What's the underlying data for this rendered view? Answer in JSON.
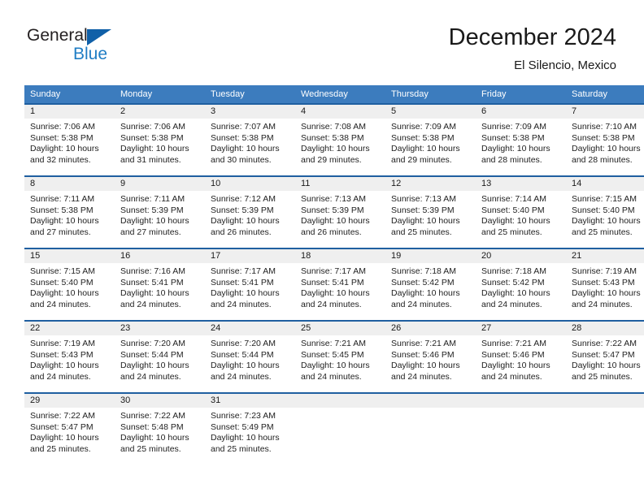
{
  "logo": {
    "word1": "General",
    "word2": "Blue",
    "triangle_color": "#1060a8",
    "blue_color": "#1f7dc4"
  },
  "header": {
    "title": "December 2024",
    "subtitle": "El Silencio, Mexico"
  },
  "theme": {
    "header_bg": "#3c7cbe",
    "row_rule": "#1f5fa0",
    "daynum_bg": "#efefef",
    "text": "#222222"
  },
  "weekday_headers": [
    "Sunday",
    "Monday",
    "Tuesday",
    "Wednesday",
    "Thursday",
    "Friday",
    "Saturday"
  ],
  "weeks": [
    [
      {
        "day": "1",
        "sunrise": "Sunrise: 7:06 AM",
        "sunset": "Sunset: 5:38 PM",
        "daylight1": "Daylight: 10 hours",
        "daylight2": "and 32 minutes."
      },
      {
        "day": "2",
        "sunrise": "Sunrise: 7:06 AM",
        "sunset": "Sunset: 5:38 PM",
        "daylight1": "Daylight: 10 hours",
        "daylight2": "and 31 minutes."
      },
      {
        "day": "3",
        "sunrise": "Sunrise: 7:07 AM",
        "sunset": "Sunset: 5:38 PM",
        "daylight1": "Daylight: 10 hours",
        "daylight2": "and 30 minutes."
      },
      {
        "day": "4",
        "sunrise": "Sunrise: 7:08 AM",
        "sunset": "Sunset: 5:38 PM",
        "daylight1": "Daylight: 10 hours",
        "daylight2": "and 29 minutes."
      },
      {
        "day": "5",
        "sunrise": "Sunrise: 7:09 AM",
        "sunset": "Sunset: 5:38 PM",
        "daylight1": "Daylight: 10 hours",
        "daylight2": "and 29 minutes."
      },
      {
        "day": "6",
        "sunrise": "Sunrise: 7:09 AM",
        "sunset": "Sunset: 5:38 PM",
        "daylight1": "Daylight: 10 hours",
        "daylight2": "and 28 minutes."
      },
      {
        "day": "7",
        "sunrise": "Sunrise: 7:10 AM",
        "sunset": "Sunset: 5:38 PM",
        "daylight1": "Daylight: 10 hours",
        "daylight2": "and 28 minutes."
      }
    ],
    [
      {
        "day": "8",
        "sunrise": "Sunrise: 7:11 AM",
        "sunset": "Sunset: 5:38 PM",
        "daylight1": "Daylight: 10 hours",
        "daylight2": "and 27 minutes."
      },
      {
        "day": "9",
        "sunrise": "Sunrise: 7:11 AM",
        "sunset": "Sunset: 5:39 PM",
        "daylight1": "Daylight: 10 hours",
        "daylight2": "and 27 minutes."
      },
      {
        "day": "10",
        "sunrise": "Sunrise: 7:12 AM",
        "sunset": "Sunset: 5:39 PM",
        "daylight1": "Daylight: 10 hours",
        "daylight2": "and 26 minutes."
      },
      {
        "day": "11",
        "sunrise": "Sunrise: 7:13 AM",
        "sunset": "Sunset: 5:39 PM",
        "daylight1": "Daylight: 10 hours",
        "daylight2": "and 26 minutes."
      },
      {
        "day": "12",
        "sunrise": "Sunrise: 7:13 AM",
        "sunset": "Sunset: 5:39 PM",
        "daylight1": "Daylight: 10 hours",
        "daylight2": "and 25 minutes."
      },
      {
        "day": "13",
        "sunrise": "Sunrise: 7:14 AM",
        "sunset": "Sunset: 5:40 PM",
        "daylight1": "Daylight: 10 hours",
        "daylight2": "and 25 minutes."
      },
      {
        "day": "14",
        "sunrise": "Sunrise: 7:15 AM",
        "sunset": "Sunset: 5:40 PM",
        "daylight1": "Daylight: 10 hours",
        "daylight2": "and 25 minutes."
      }
    ],
    [
      {
        "day": "15",
        "sunrise": "Sunrise: 7:15 AM",
        "sunset": "Sunset: 5:40 PM",
        "daylight1": "Daylight: 10 hours",
        "daylight2": "and 24 minutes."
      },
      {
        "day": "16",
        "sunrise": "Sunrise: 7:16 AM",
        "sunset": "Sunset: 5:41 PM",
        "daylight1": "Daylight: 10 hours",
        "daylight2": "and 24 minutes."
      },
      {
        "day": "17",
        "sunrise": "Sunrise: 7:17 AM",
        "sunset": "Sunset: 5:41 PM",
        "daylight1": "Daylight: 10 hours",
        "daylight2": "and 24 minutes."
      },
      {
        "day": "18",
        "sunrise": "Sunrise: 7:17 AM",
        "sunset": "Sunset: 5:41 PM",
        "daylight1": "Daylight: 10 hours",
        "daylight2": "and 24 minutes."
      },
      {
        "day": "19",
        "sunrise": "Sunrise: 7:18 AM",
        "sunset": "Sunset: 5:42 PM",
        "daylight1": "Daylight: 10 hours",
        "daylight2": "and 24 minutes."
      },
      {
        "day": "20",
        "sunrise": "Sunrise: 7:18 AM",
        "sunset": "Sunset: 5:42 PM",
        "daylight1": "Daylight: 10 hours",
        "daylight2": "and 24 minutes."
      },
      {
        "day": "21",
        "sunrise": "Sunrise: 7:19 AM",
        "sunset": "Sunset: 5:43 PM",
        "daylight1": "Daylight: 10 hours",
        "daylight2": "and 24 minutes."
      }
    ],
    [
      {
        "day": "22",
        "sunrise": "Sunrise: 7:19 AM",
        "sunset": "Sunset: 5:43 PM",
        "daylight1": "Daylight: 10 hours",
        "daylight2": "and 24 minutes."
      },
      {
        "day": "23",
        "sunrise": "Sunrise: 7:20 AM",
        "sunset": "Sunset: 5:44 PM",
        "daylight1": "Daylight: 10 hours",
        "daylight2": "and 24 minutes."
      },
      {
        "day": "24",
        "sunrise": "Sunrise: 7:20 AM",
        "sunset": "Sunset: 5:44 PM",
        "daylight1": "Daylight: 10 hours",
        "daylight2": "and 24 minutes."
      },
      {
        "day": "25",
        "sunrise": "Sunrise: 7:21 AM",
        "sunset": "Sunset: 5:45 PM",
        "daylight1": "Daylight: 10 hours",
        "daylight2": "and 24 minutes."
      },
      {
        "day": "26",
        "sunrise": "Sunrise: 7:21 AM",
        "sunset": "Sunset: 5:46 PM",
        "daylight1": "Daylight: 10 hours",
        "daylight2": "and 24 minutes."
      },
      {
        "day": "27",
        "sunrise": "Sunrise: 7:21 AM",
        "sunset": "Sunset: 5:46 PM",
        "daylight1": "Daylight: 10 hours",
        "daylight2": "and 24 minutes."
      },
      {
        "day": "28",
        "sunrise": "Sunrise: 7:22 AM",
        "sunset": "Sunset: 5:47 PM",
        "daylight1": "Daylight: 10 hours",
        "daylight2": "and 25 minutes."
      }
    ],
    [
      {
        "day": "29",
        "sunrise": "Sunrise: 7:22 AM",
        "sunset": "Sunset: 5:47 PM",
        "daylight1": "Daylight: 10 hours",
        "daylight2": "and 25 minutes."
      },
      {
        "day": "30",
        "sunrise": "Sunrise: 7:22 AM",
        "sunset": "Sunset: 5:48 PM",
        "daylight1": "Daylight: 10 hours",
        "daylight2": "and 25 minutes."
      },
      {
        "day": "31",
        "sunrise": "Sunrise: 7:23 AM",
        "sunset": "Sunset: 5:49 PM",
        "daylight1": "Daylight: 10 hours",
        "daylight2": "and 25 minutes."
      },
      {
        "day": "",
        "sunrise": "",
        "sunset": "",
        "daylight1": "",
        "daylight2": ""
      },
      {
        "day": "",
        "sunrise": "",
        "sunset": "",
        "daylight1": "",
        "daylight2": ""
      },
      {
        "day": "",
        "sunrise": "",
        "sunset": "",
        "daylight1": "",
        "daylight2": ""
      },
      {
        "day": "",
        "sunrise": "",
        "sunset": "",
        "daylight1": "",
        "daylight2": ""
      }
    ]
  ]
}
